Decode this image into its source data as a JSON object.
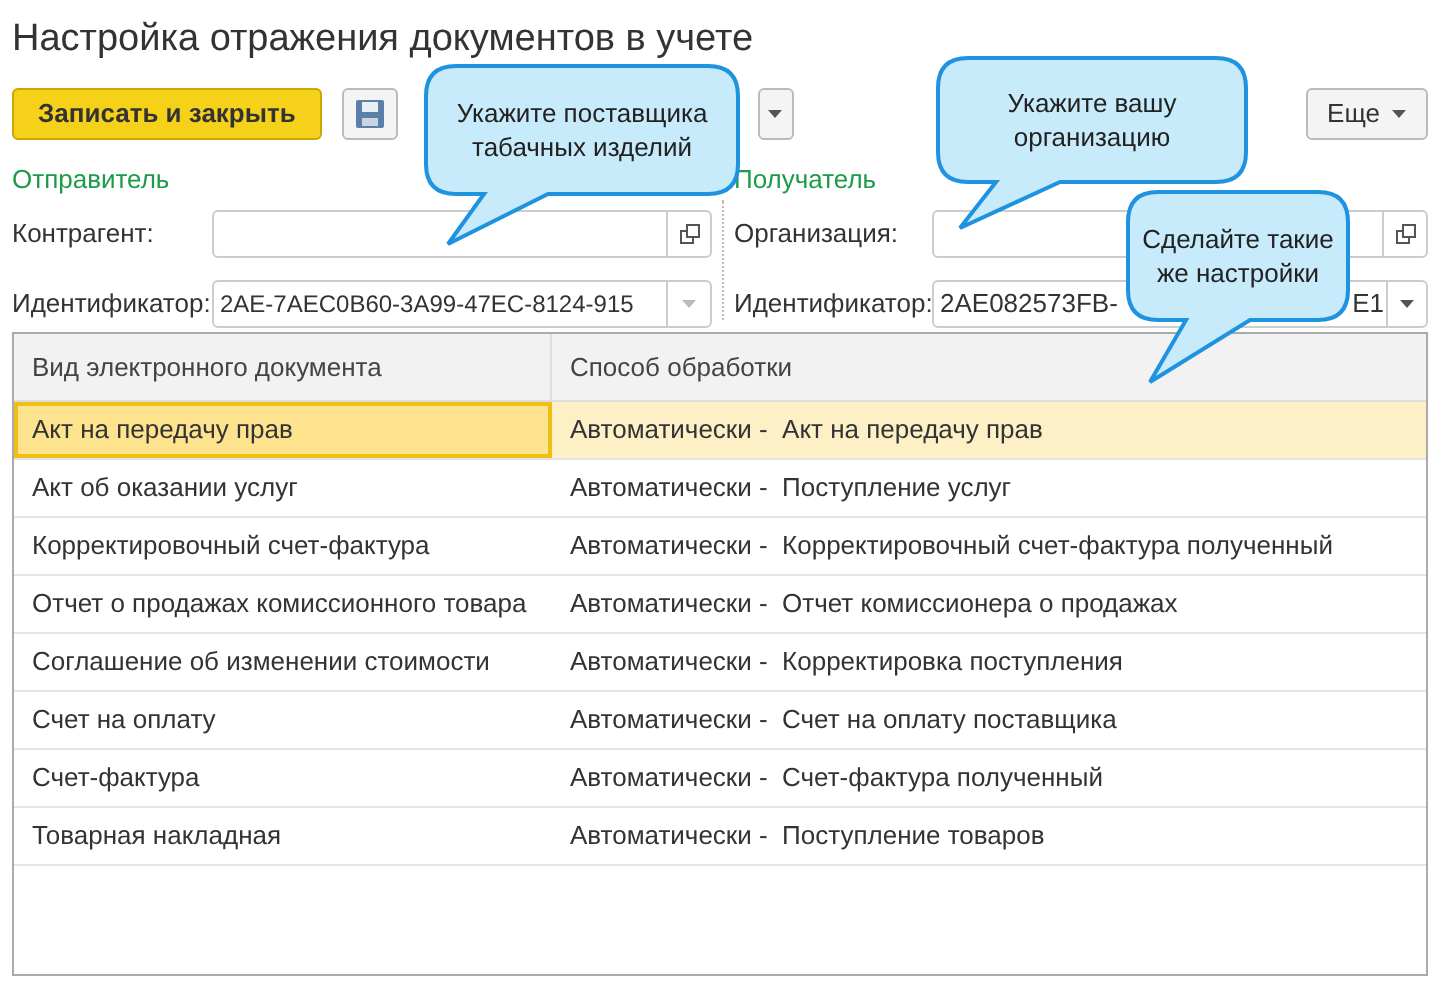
{
  "window": {
    "title": "Настройка отражения документов в учете"
  },
  "toolbar": {
    "primary_button": "Записать и закрыть",
    "more_button": "Еще"
  },
  "sender": {
    "heading": "Отправитель",
    "counterparty_label": "Контрагент:",
    "identifier_label": "Идентификатор:",
    "identifier_value": "2AE-7AEC0B60-3A99-47EC-8124-915"
  },
  "receiver": {
    "heading": "Получатель",
    "organization_label": "Организация:",
    "identifier_label": "Идентификатор:",
    "identifier_value": "2AE082573FB-",
    "identifier_value_end": "E1"
  },
  "table": {
    "columns": [
      "Вид электронного документа",
      "Способ обработки"
    ],
    "rows": [
      {
        "cells": [
          "Акт на передачу прав",
          "Автоматически -  Акт на передачу прав"
        ],
        "selected": true
      },
      {
        "cells": [
          "Акт об оказании услуг",
          "Автоматически -  Поступление услуг"
        ],
        "selected": false
      },
      {
        "cells": [
          "Корректировочный счет-фактура",
          "Автоматически -  Корректировочный счет-фактура полученный"
        ],
        "selected": false
      },
      {
        "cells": [
          "Отчет о продажах комиссионного товара",
          "Автоматически -  Отчет комиссионера о продажах"
        ],
        "selected": false
      },
      {
        "cells": [
          "Соглашение об изменении стоимости",
          "Автоматически -  Корректировка поступления"
        ],
        "selected": false
      },
      {
        "cells": [
          "Счет на оплату",
          "Автоматически -  Счет на оплату поставщика"
        ],
        "selected": false
      },
      {
        "cells": [
          "Счет-фактура",
          "Автоматически -  Счет-фактура полученный"
        ],
        "selected": false
      },
      {
        "cells": [
          "Товарная накладная",
          "Автоматически -  Поступление товаров"
        ],
        "selected": false
      }
    ]
  },
  "callouts": [
    {
      "text": "Укажите поставщика табачных изделий"
    },
    {
      "text": "Укажите вашу организацию"
    },
    {
      "text": "Сделайте такие же настройки"
    }
  ]
}
